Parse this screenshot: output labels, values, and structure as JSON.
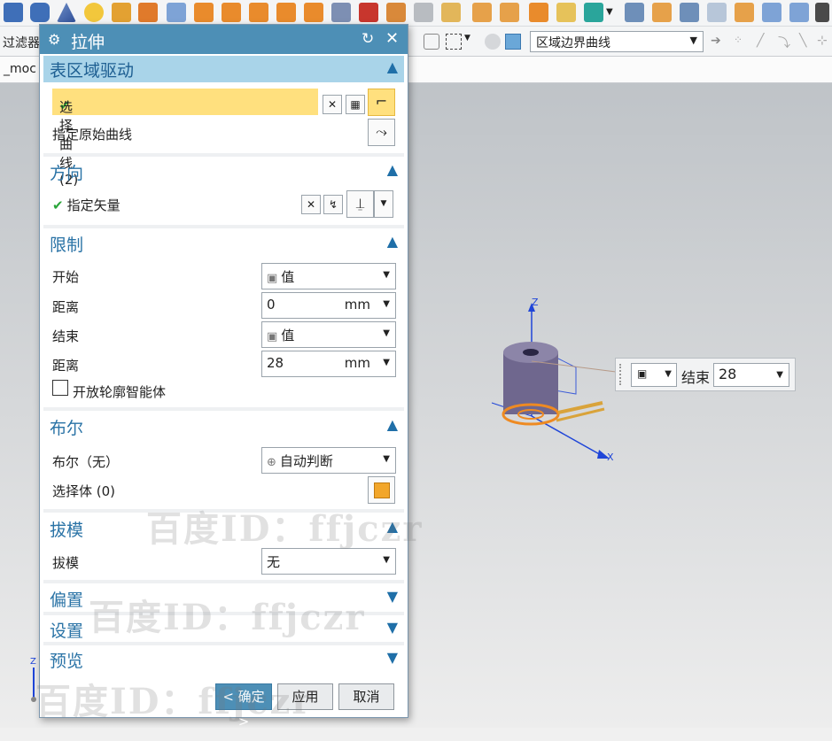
{
  "toolbar2": {
    "filter_label": "过滤器",
    "curve_rule": "区域边界曲线"
  },
  "tabstrip": {
    "model_tab": "_moc"
  },
  "dialog": {
    "title": "拉伸",
    "sections": {
      "region_drive": {
        "title": "表区域驱动",
        "select_curve": "选择曲线 (2)",
        "specify_original_curve": "指定原始曲线"
      },
      "direction": {
        "title": "方向",
        "specify_vector": "指定矢量"
      },
      "limits": {
        "title": "限制",
        "start_label": "开始",
        "start_value": "值",
        "start_distance_label": "距离",
        "start_distance_value": "0",
        "start_distance_unit": "mm",
        "end_label": "结束",
        "end_value": "值",
        "end_distance_label": "距离",
        "end_distance_value": "28",
        "end_distance_unit": "mm",
        "open_profile_label": "开放轮廓智能体"
      },
      "boolean": {
        "title": "布尔",
        "boolean_label": "布尔（无）",
        "boolean_value": "自动判断",
        "select_body": "选择体 (0)"
      },
      "draft": {
        "title": "拔模",
        "draft_label": "拔模",
        "draft_value": "无"
      },
      "offset": {
        "title": "偏置"
      },
      "settings": {
        "title": "设置"
      },
      "preview": {
        "title": "预览"
      }
    },
    "buttons": {
      "ok": "< 确定 >",
      "apply": "应用",
      "cancel": "取消"
    }
  },
  "end_popup": {
    "label": "结束",
    "value": "28"
  },
  "watermark": "百度ID：ffjczr",
  "axes": {
    "x": "X",
    "z": "Z"
  }
}
